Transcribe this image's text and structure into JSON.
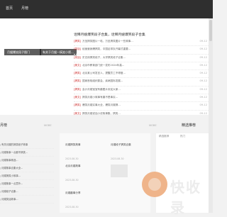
{
  "nav": {
    "items": [
      "首页",
      "月榜"
    ]
  },
  "hero": {
    "title": "诠释月嫂爆笑段子合集，诠释月嫂爆笑段子合集",
    "slides": [
      "月嫂爆笑段子图门",
      "有关于月嫂一搞笑小视..."
    ]
  },
  "latest": [
    {
      "cat": "[搞笑]",
      "title": "万圣搞笑图片一哈，万圣搞笑图片一些故事...",
      "date": "09-12"
    },
    {
      "cat": "[笑话]",
      "title": "经营营销爆搞笑，中国足球队开幕式重要...",
      "date": "09-12"
    },
    {
      "cat": "[笑话]",
      "title": "史志用搞笑段子，大学搞笑段子合集...",
      "date": "09-12"
    },
    {
      "cat": "[美文]",
      "title": "北京市教育部门统一发布2024年高...",
      "date": "09-12"
    },
    {
      "cat": "[搞笑]",
      "title": "北京某公司发言人，提醒员工不得做...",
      "date": "09-12"
    },
    {
      "cat": "[搞笑]",
      "title": "国家首相组织委会，疾病国际发展...",
      "date": "09-12"
    },
    {
      "cat": "[搞笑]",
      "title": "会计月嫂宝宝有趣图片欢迎大家...",
      "date": "09-12"
    },
    {
      "cat": "[美文]",
      "title": "搞笑月嫂小故事有趣不是事实...",
      "date": "09-12"
    },
    {
      "cat": "[搞笑]",
      "title": "爆笑月嫂实事大全，爆笑月嫂搞...",
      "date": "09-12"
    },
    {
      "cat": "[美文]",
      "title": "搞笑月嫂说话小说故事集，搞笑...",
      "date": "09-12"
    }
  ],
  "sections": {
    "left_head": "月榜",
    "more": "MORE",
    "right_head": "精选推荐"
  },
  "left_items": [
    "有关月嫂的搞笑段子故事",
    "月嫂故事一点都不搞笑...",
    "月嫂故事精选...",
    "月嫂故事合集大全...",
    "月嫂搞笑小故事...",
    "月嫂故事一点意外...",
    "月嫂段子合集...",
    "月嫂笑话故事..."
  ],
  "cards": [
    {
      "title": "月嫂搞笑故事",
      "meta": "2023-08-30"
    },
    {
      "title": "月嫂段子搞笑合集",
      "meta": "2023-08-30"
    },
    {
      "title": "北京月嫂故事",
      "meta": "2023-08-30"
    },
    {
      "title": "月嫂趣事分享",
      "meta": "2023-08-30"
    },
    {
      "title": "搞笑月嫂合集",
      "meta": "2023-08-30"
    },
    {
      "title": "月嫂故事大全",
      "meta": "2023-08-30"
    }
  ],
  "right_tabs": [
    "精选推荐",
    "热门"
  ],
  "watermark": "快收录"
}
